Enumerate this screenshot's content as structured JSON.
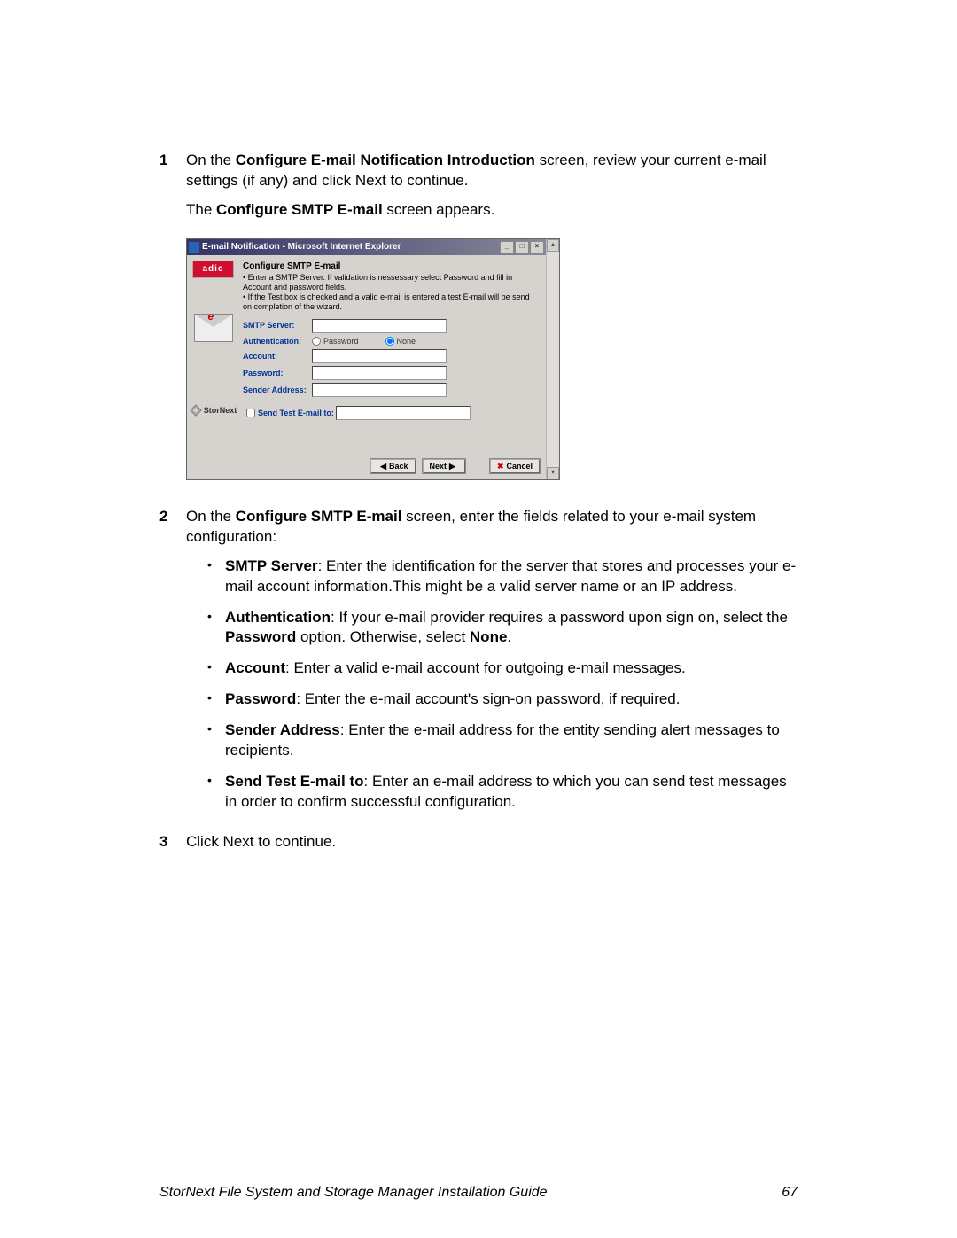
{
  "steps": {
    "s1": {
      "num": "1",
      "line1_pre": "On the ",
      "line1_bold": "Configure E-mail Notification Introduction",
      "line1_post": " screen, review your current e-mail settings (if any) and click Next to continue.",
      "line2_pre": "The ",
      "line2_bold": "Configure SMTP E-mail",
      "line2_post": " screen appears."
    },
    "s2": {
      "num": "2",
      "line1_pre": "On the ",
      "line1_bold": "Configure SMTP E-mail",
      "line1_post": " screen, enter the fields related to your e-mail system configuration:"
    },
    "s3": {
      "num": "3",
      "text": "Click Next to continue."
    }
  },
  "bullets": {
    "b1_bold": "SMTP Server",
    "b1_text": ": Enter the identification for the server that stores and processes your e-mail account information.This might be a valid server name or an IP address.",
    "b2_bold": "Authentication",
    "b2_mid1": ": If your e-mail provider requires a password upon sign on, select the ",
    "b2_bold2": "Password",
    "b2_mid2": " option. Otherwise, select ",
    "b2_bold3": "None",
    "b2_end": ".",
    "b3_bold": "Account",
    "b3_text": ": Enter a valid e-mail account for outgoing e-mail messages.",
    "b4_bold": "Password",
    "b4_text": ": Enter the e-mail account's sign-on password, if required.",
    "b5_bold": "Sender Address",
    "b5_text": ": Enter the e-mail address for the entity sending alert messages to recipients.",
    "b6_bold": "Send Test E-mail to",
    "b6_text": ": Enter an e-mail address to which you can send test messages in order to confirm successful configuration."
  },
  "dialog": {
    "title": "E-mail Notification - Microsoft Internet Explorer",
    "brand": "adic",
    "envelope_e": "e",
    "stornext": "StorNext",
    "panel_title": "Configure SMTP E-mail",
    "hint1": "• Enter a SMTP Server. If validation is nessessary select Password and fill in Account and password fields.",
    "hint2": "• If the Test box is checked and a valid e-mail is entered a test E-mail will be send on completion of the wizard.",
    "labels": {
      "smtp": "SMTP Server:",
      "auth": "Authentication:",
      "account": "Account:",
      "password": "Password:",
      "sender": "Sender Address:",
      "test": "Send Test E-mail to:"
    },
    "auth_password": "Password",
    "auth_none": "None",
    "buttons": {
      "back": "Back",
      "next": "Next",
      "cancel": "Cancel"
    }
  },
  "footer": {
    "title": "StorNext File System and Storage Manager Installation Guide",
    "page": "67"
  }
}
